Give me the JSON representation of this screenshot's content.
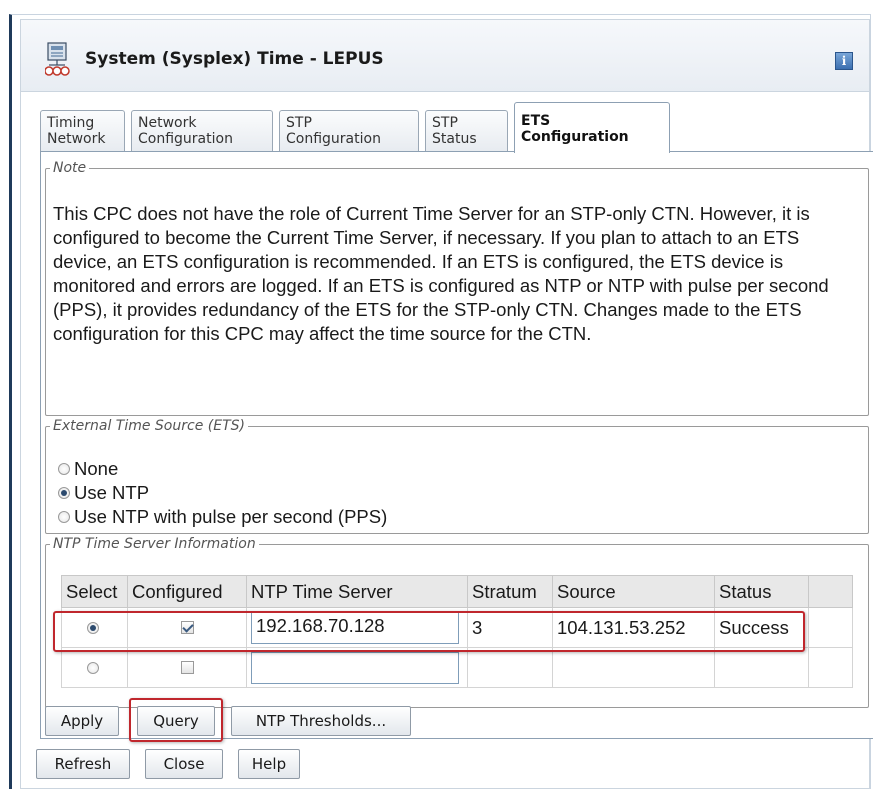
{
  "window": {
    "title": "System (Sysplex) Time - LEPUS",
    "info_label": "i"
  },
  "tabs": [
    {
      "line1": "Timing",
      "line2": "Network",
      "active": false
    },
    {
      "line1": "Network",
      "line2": "Configuration",
      "active": false
    },
    {
      "line1": "STP",
      "line2": "Configuration",
      "active": false
    },
    {
      "line1": "STP",
      "line2": "Status",
      "active": false
    },
    {
      "line1": "ETS",
      "line2": "Configuration",
      "active": true
    }
  ],
  "note": {
    "legend": "Note",
    "text": "This CPC does not have the role of Current Time Server for an STP-only CTN. However, it is configured to become the Current Time Server, if necessary. If you plan to attach to an ETS device, an ETS configuration is recommended. If an ETS is configured, the ETS device is monitored and errors are logged. If an ETS is configured as NTP or NTP with pulse per second (PPS), it provides redundancy of the ETS for the STP-only CTN. Changes made to the ETS configuration for this CPC may affect the time source for the CTN."
  },
  "ets": {
    "legend": "External Time Source (ETS)",
    "options": [
      {
        "label": "None",
        "selected": false
      },
      {
        "label": "Use NTP",
        "selected": true
      },
      {
        "label": "Use NTP with pulse per second (PPS)",
        "selected": false
      }
    ]
  },
  "ntp": {
    "legend": "NTP Time Server Information",
    "columns": [
      "Select",
      "Configured",
      "NTP Time Server",
      "Stratum",
      "Source",
      "Status"
    ],
    "rows": [
      {
        "selected": true,
        "configured": true,
        "server": "192.168.70.128",
        "stratum": "3",
        "source": "104.131.53.252",
        "status": "Success"
      },
      {
        "selected": false,
        "configured": false,
        "server": "",
        "stratum": "",
        "source": "",
        "status": ""
      }
    ]
  },
  "buttons": {
    "apply": "Apply",
    "query": "Query",
    "thresholds": "NTP Thresholds...",
    "refresh": "Refresh",
    "close": "Close",
    "help": "Help"
  },
  "colors": {
    "highlight": "#c0272d",
    "frame_border": "#1f3a5a"
  }
}
